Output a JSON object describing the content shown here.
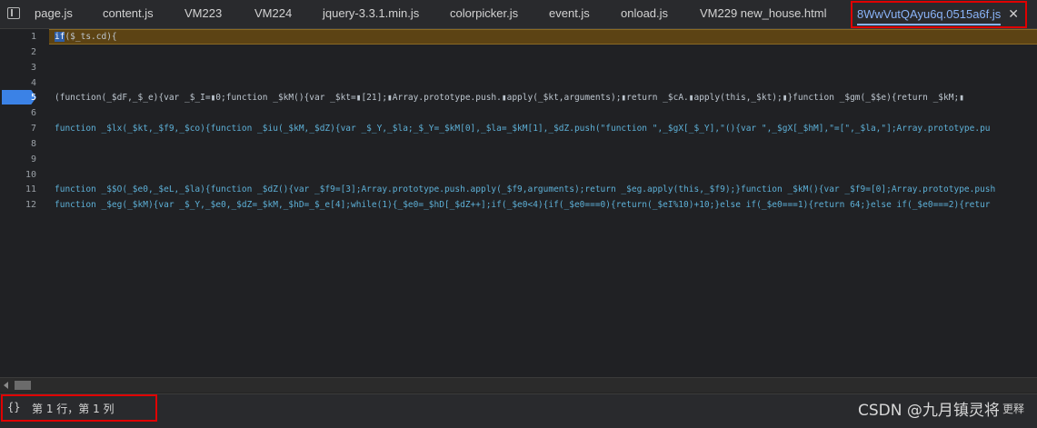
{
  "tabs": [
    {
      "label": "page.js",
      "active": false
    },
    {
      "label": "content.js",
      "active": false
    },
    {
      "label": "VM223",
      "active": false
    },
    {
      "label": "VM224",
      "active": false
    },
    {
      "label": "jquery-3.3.1.min.js",
      "active": false
    },
    {
      "label": "colorpicker.js",
      "active": false
    },
    {
      "label": "event.js",
      "active": false
    },
    {
      "label": "onload.js",
      "active": false
    },
    {
      "label": "VM229 new_house.html",
      "active": false
    },
    {
      "label": "8WwVutQAyu6q.0515a6f.js",
      "active": true
    }
  ],
  "tab_close_glyph": "✕",
  "line_numbers": [
    "1",
    "2",
    "3",
    "4",
    "5",
    "6",
    "7",
    "8",
    "9",
    "10",
    "11",
    "12"
  ],
  "current_line": "5",
  "code": {
    "line1_kw": "if",
    "line1_rest": "($_ts.cd){",
    "line5": "(function(_$dF,_$_e){var _$_I=▮0;function _$kM(){var _$kt=▮[21];▮Array.prototype.push.▮apply(_$kt,arguments);▮return _$cA.▮apply(this,_$kt);▮}function _$gm(_$$e){return _$kM;▮",
    "line7": "function _$lx(_$kt,_$f9,_$co){function _$iu(_$kM,_$dZ){var _$_Y,_$la;_$_Y=_$kM[0],_$la=_$kM[1],_$dZ.push(\"function \",_$gX[_$_Y],\"(){var \",_$gX[_$hM],\"=[\",_$la,\"];Array.prototype.pu",
    "line11": "function _$$O(_$e0,_$eL,_$la){function _$dZ(){var _$f9=[3];Array.prototype.push.apply(_$f9,arguments);return _$eg.apply(this,_$f9);}function _$kM(){var _$f9=[0];Array.prototype.push",
    "line12": "function _$eg(_$kM){var _$_Y,_$e0,_$dZ=_$kM,_$hD=_$_e[4];while(1){_$e0=_$hD[_$dZ++];if(_$e0<4){if(_$e0===0){return(_$eI%10)+10;}else if(_$e0===1){return 64;}else if(_$e0===2){retur"
  },
  "status": {
    "braces_icon_text": "{}",
    "cursor_position": "第 1 行，第 1 列",
    "more_label": "更释"
  },
  "watermark": "CSDN @九月镇灵将",
  "icons": {
    "panel_toggle": "sidebar-toggle-icon",
    "braces": "pretty-print-icon",
    "close": "close-icon"
  },
  "colors": {
    "active_tab": "#8ab4f8",
    "highlight_box": "#e00000",
    "current_line_bg": "#5c4314",
    "keyword": "#5db0d7",
    "breakpoint": "#3b82e6"
  }
}
